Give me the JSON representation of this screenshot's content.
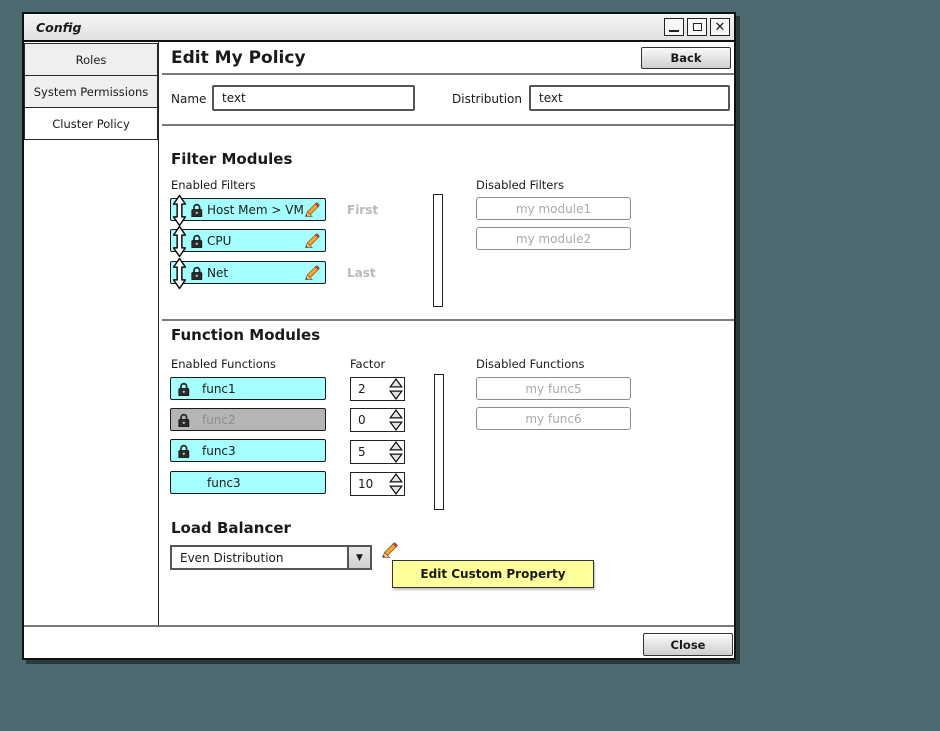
{
  "window": {
    "title": "Config"
  },
  "window_controls": {
    "minimize": "minimize-window",
    "maximize": "maximize-window",
    "close": "close-window"
  },
  "sidebar": {
    "items": [
      {
        "label": "Roles",
        "active": false
      },
      {
        "label": "System Permissions",
        "active": false
      },
      {
        "label": "Cluster Policy",
        "active": true
      }
    ]
  },
  "header": {
    "title": "Edit My Policy",
    "back_label": "Back"
  },
  "form": {
    "name_label": "Name",
    "name_value": "text",
    "distribution_label": "Distribution",
    "distribution_value": "text"
  },
  "filter_modules": {
    "title": "Filter Modules",
    "enabled_label": "Enabled Filters",
    "disabled_label": "Disabled Filters",
    "first_label": "First",
    "last_label": "Last",
    "enabled": [
      {
        "label": "Host Mem > VM",
        "locked": true
      },
      {
        "label": "CPU",
        "locked": true
      },
      {
        "label": "Net",
        "locked": true
      }
    ],
    "disabled": [
      "my module1",
      "my module2"
    ]
  },
  "function_modules": {
    "title": "Function Modules",
    "enabled_label": "Enabled Functions",
    "factor_label": "Factor",
    "disabled_label": "Disabled Functions",
    "enabled": [
      {
        "label": "func1",
        "locked": true,
        "state": "enabled",
        "factor": "2"
      },
      {
        "label": "func2",
        "locked": true,
        "state": "disabled",
        "factor": "0"
      },
      {
        "label": "func3",
        "locked": true,
        "state": "enabled",
        "factor": "5"
      },
      {
        "label": "func3",
        "locked": false,
        "state": "enabled",
        "factor": "10"
      }
    ],
    "disabled": [
      "my func5",
      "my func6"
    ]
  },
  "load_balancer": {
    "title": "Load Balancer",
    "selected": "Even Distribution",
    "edit_note": "Edit Custom Property"
  },
  "footer": {
    "close_label": "Close"
  },
  "colors": {
    "desktop": "#4d6a70",
    "accent_cyan": "#a6ffff",
    "disabled_grey": "#b5b5b5",
    "note_yellow": "#ffff9c"
  }
}
